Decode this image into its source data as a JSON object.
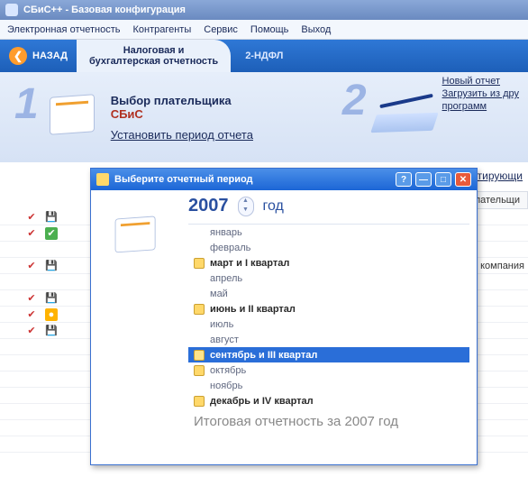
{
  "titlebar": {
    "text": "СБиС++  - Базовая конфигурация"
  },
  "menu": {
    "items": [
      "Электронная отчетность",
      "Контрагенты",
      "Сервис",
      "Помощь",
      "Выход"
    ]
  },
  "nav": {
    "back": "НАЗАД",
    "tab_active_l1": "Налоговая и",
    "tab_active_l2": "бухгалтерская отчетность",
    "tab_inactive": "2-НДФЛ"
  },
  "step1": {
    "title": "Выбор плательщика",
    "company": "СБиС",
    "set_period": "Установить период отчета"
  },
  "step2": {
    "new_report": "Новый отчет",
    "load_l1": "Загрузить из дру",
    "load_l2": "программ",
    "redact": "ктирующи"
  },
  "table": {
    "col_payer": "Плательщи",
    "row4_text": "ОР компания"
  },
  "dialog": {
    "title": "Выберите отчетный период",
    "year": "2007",
    "year_label": "год",
    "periods": [
      {
        "label": "январь",
        "bold": false,
        "icon": false,
        "selected": false
      },
      {
        "label": "февраль",
        "bold": false,
        "icon": false,
        "selected": false
      },
      {
        "label": "март и I квартал",
        "bold": true,
        "icon": true,
        "selected": false
      },
      {
        "label": "апрель",
        "bold": false,
        "icon": false,
        "selected": false
      },
      {
        "label": "май",
        "bold": false,
        "icon": false,
        "selected": false
      },
      {
        "label": "июнь и II квартал",
        "bold": true,
        "icon": true,
        "selected": false
      },
      {
        "label": "июль",
        "bold": false,
        "icon": false,
        "selected": false
      },
      {
        "label": "август",
        "bold": false,
        "icon": false,
        "selected": false
      },
      {
        "label": "сентябрь и III квартал",
        "bold": true,
        "icon": true,
        "selected": true
      },
      {
        "label": "октябрь",
        "bold": false,
        "icon": true,
        "selected": false
      },
      {
        "label": "ноябрь",
        "bold": false,
        "icon": false,
        "selected": false
      },
      {
        "label": "декабрь и IV квартал",
        "bold": true,
        "icon": true,
        "selected": false
      }
    ],
    "summary": "Итоговая отчетность за 2007 год"
  }
}
